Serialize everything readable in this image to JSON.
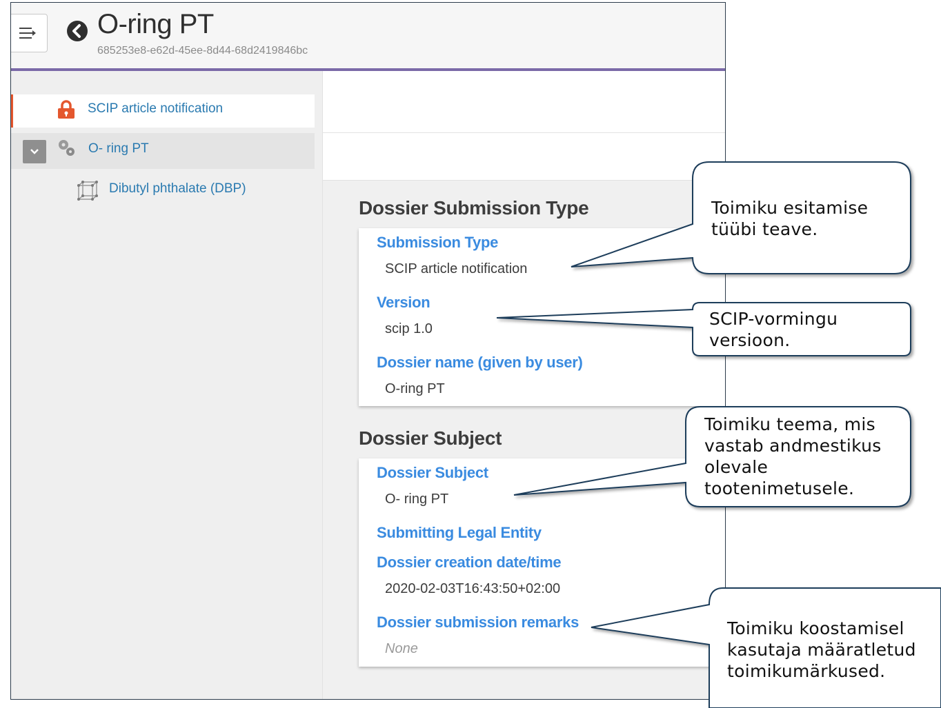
{
  "header": {
    "title": "O-ring PT",
    "subtitle": "685253e8-e62d-45ee-8d44-68d2419846bc"
  },
  "sidebar": {
    "items": [
      {
        "label": "SCIP article notification",
        "icon": "lock-icon"
      },
      {
        "label": "O- ring PT",
        "icon": "gears-icon"
      },
      {
        "label": "Dibutyl phthalate (DBP)",
        "icon": "molecule-icon"
      }
    ]
  },
  "sections": [
    {
      "title": "Dossier Submission Type",
      "fields": [
        {
          "label": "Submission Type",
          "value": "SCIP article notification"
        },
        {
          "label": "Version",
          "value": "scip 1.0"
        },
        {
          "label": "Dossier name (given by user)",
          "value": "O-ring PT"
        }
      ]
    },
    {
      "title": "Dossier Subject",
      "fields": [
        {
          "label": "Dossier Subject",
          "value": "O- ring PT"
        },
        {
          "label": "Submitting Legal Entity",
          "value": ""
        },
        {
          "label": "Dossier creation date/time",
          "value": "2020-02-03T16:43:50+02:00"
        },
        {
          "label": "Dossier submission remarks",
          "value": "None"
        }
      ]
    }
  ],
  "callouts": [
    {
      "lines": [
        "Toimiku esitamise",
        "tüübi teave."
      ]
    },
    {
      "lines": [
        "SCIP-vormingu",
        "versioon."
      ]
    },
    {
      "lines": [
        "Toimiku teema, mis",
        "vastab andmestikus",
        "olevale",
        "tootenimetusele."
      ]
    },
    {
      "lines": [
        "Toimiku koostamisel",
        "kasutaja määratletud",
        "toimikumärkused."
      ]
    }
  ],
  "colors": {
    "accent_purple": "#7b6aa8",
    "link_blue": "#3a8be0",
    "lock_orange": "#e4572e",
    "callout_border": "#1f3c5a"
  }
}
